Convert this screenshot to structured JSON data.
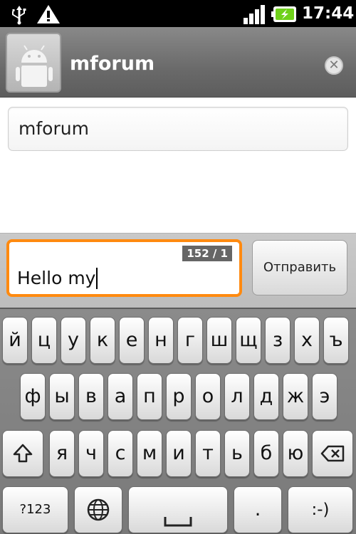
{
  "status_bar": {
    "time": "17:44",
    "icons": [
      "usb-icon",
      "warning-icon",
      "signal-icon",
      "battery-charging-icon"
    ]
  },
  "conversation": {
    "contact_name": "mforum",
    "close_icon": "close-icon"
  },
  "recipient": {
    "value": "mforum"
  },
  "compose": {
    "counter": "152 / 1",
    "message": "Hello my",
    "send_label": "Отправить"
  },
  "keyboard": {
    "row1": [
      "й",
      "ц",
      "у",
      "к",
      "е",
      "н",
      "г",
      "ш",
      "щ",
      "з",
      "х",
      "ъ"
    ],
    "row2": [
      "ф",
      "ы",
      "в",
      "а",
      "п",
      "р",
      "о",
      "л",
      "д",
      "ж",
      "э"
    ],
    "row3": [
      "я",
      "ч",
      "с",
      "м",
      "и",
      "т",
      "ь",
      "б",
      "ю"
    ],
    "symbols_label": "?123",
    "period_label": ".",
    "smiley_label": ":-)",
    "icons": [
      "shift-icon",
      "backspace-icon",
      "globe-icon",
      "space-icon"
    ]
  },
  "colors": {
    "focus_accent": "#ff8a10",
    "battery_green": "#6fd11a"
  }
}
